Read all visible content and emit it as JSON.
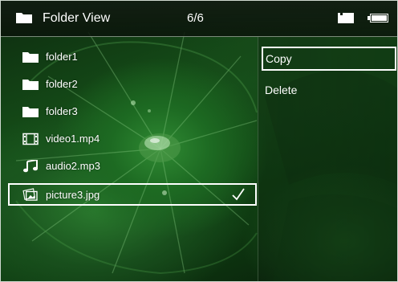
{
  "header": {
    "title": "Folder View",
    "counter": "6/6",
    "left_icon": "folder-icon",
    "right_icons": [
      "memory-card-icon",
      "battery-icon"
    ]
  },
  "file_list": {
    "items": [
      {
        "label": "folder1",
        "icon": "folder-icon",
        "selected": false
      },
      {
        "label": "folder2",
        "icon": "folder-icon",
        "selected": false
      },
      {
        "label": "folder3",
        "icon": "folder-icon",
        "selected": false
      },
      {
        "label": "video1.mp4",
        "icon": "film-icon",
        "selected": false
      },
      {
        "label": "audio2.mp3",
        "icon": "music-note-icon",
        "selected": false
      },
      {
        "label": "picture3.jpg",
        "icon": "picture-icon",
        "selected": true,
        "checked": true
      }
    ]
  },
  "context_menu": {
    "items": [
      {
        "label": "Copy",
        "active": true
      },
      {
        "label": "Delete",
        "active": false
      }
    ]
  },
  "colors": {
    "text": "#ffffff",
    "highlight_border": "#ffffff",
    "background_green": "#1d6a22"
  }
}
